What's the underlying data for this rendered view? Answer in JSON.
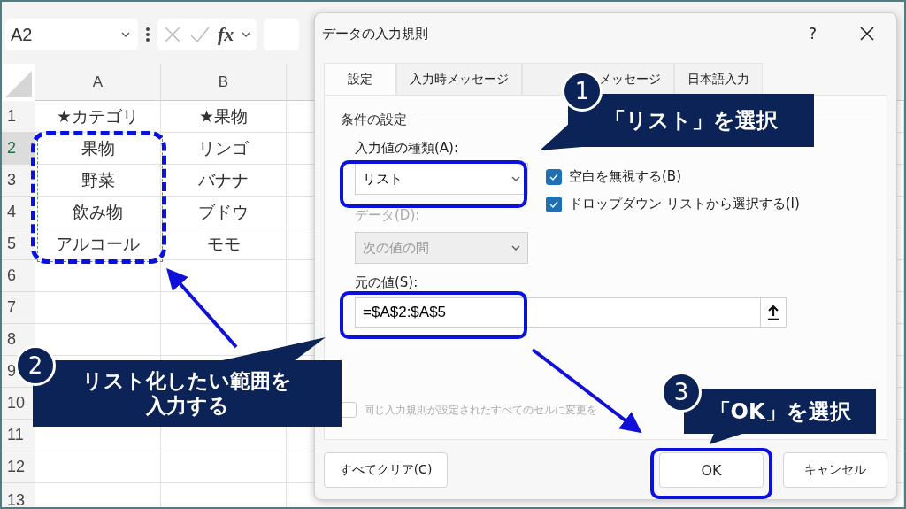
{
  "sheet": {
    "name_box": "A2",
    "formula_label": "fx",
    "columns": [
      {
        "label": "A"
      },
      {
        "label": "B"
      }
    ],
    "rows": [
      {
        "number": "1",
        "selected": false,
        "cells": [
          "★カテゴリ",
          "★果物"
        ]
      },
      {
        "number": "2",
        "selected": true,
        "cells": [
          "果物",
          "リンゴ"
        ]
      },
      {
        "number": "3",
        "selected": false,
        "cells": [
          "野菜",
          "バナナ"
        ]
      },
      {
        "number": "4",
        "selected": false,
        "cells": [
          "飲み物",
          "ブドウ"
        ]
      },
      {
        "number": "5",
        "selected": false,
        "cells": [
          "アルコール",
          "モモ"
        ]
      },
      {
        "number": "6",
        "selected": false
      },
      {
        "number": "7",
        "selected": false
      },
      {
        "number": "8",
        "selected": false
      },
      {
        "number": "9",
        "selected": false
      },
      {
        "number": "10",
        "selected": false
      },
      {
        "number": "11",
        "selected": false
      },
      {
        "number": "12",
        "selected": false
      },
      {
        "number": "13",
        "selected": false
      }
    ]
  },
  "dialog": {
    "title": "データの入力規則",
    "help": "?",
    "tabs": [
      {
        "label": "設定",
        "selected": true
      },
      {
        "label": "入力時メッセージ",
        "selected": false
      },
      {
        "label": "メッセージ",
        "selected": false
      },
      {
        "label": "日本語入力",
        "selected": false
      }
    ],
    "section": "条件の設定",
    "allow": {
      "label": "入力値の種類(A):",
      "value": "リスト"
    },
    "options": [
      {
        "label": "空白を無視する(B)",
        "checked": true
      },
      {
        "label": "ドロップダウン リストから選択する(I)",
        "checked": true
      }
    ],
    "data": {
      "label": "データ(D):",
      "value": "次の値の間",
      "disabled": true
    },
    "source": {
      "label": "元の値(S):",
      "value": "=$A$2:$A$5"
    },
    "apply_all": {
      "label": "同じ入力規則が設定されたすべてのセルに変更を",
      "checked": false,
      "disabled": true
    },
    "buttons": [
      {
        "label": "すべてクリア(C)",
        "kind": "clear"
      },
      {
        "label": "OK",
        "kind": "ok"
      },
      {
        "label": "キャンセル",
        "kind": "cancel"
      }
    ]
  },
  "annotations": [
    {
      "number": "1",
      "text": "「リスト」を選択"
    },
    {
      "number": "2",
      "text": "リスト化したい範囲を入力する"
    },
    {
      "number": "3",
      "text": "「OK」を選択"
    }
  ]
}
